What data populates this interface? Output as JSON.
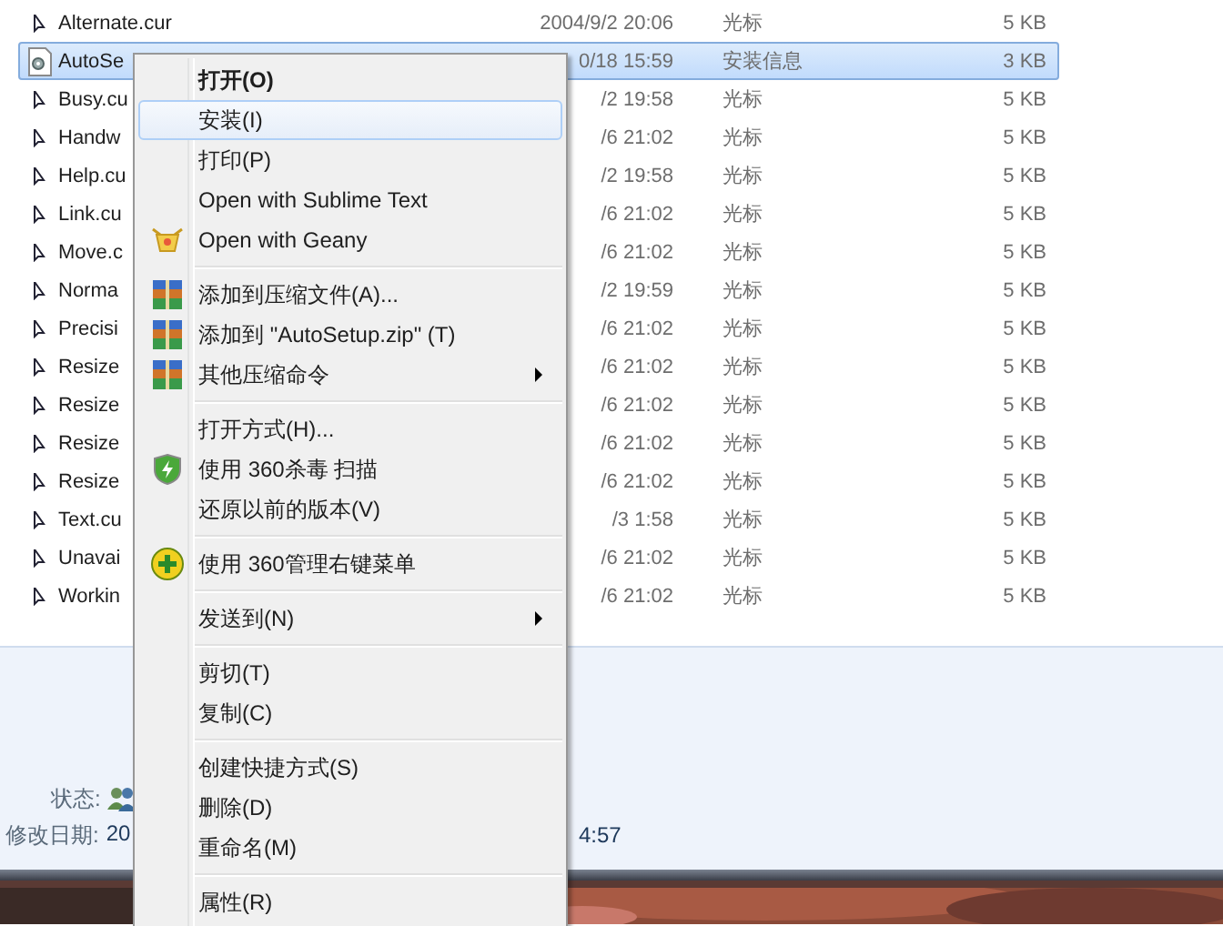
{
  "files": [
    {
      "name": "Alternate.cur",
      "date": "2004/9/2 20:06",
      "type": "光标",
      "size": "5 KB",
      "kind": "cursor",
      "selected": false
    },
    {
      "name": "AutoSe",
      "date": "0/18 15:59",
      "type": "安装信息",
      "size": "3 KB",
      "kind": "document",
      "selected": true
    },
    {
      "name": "Busy.cu",
      "date": "/2 19:58",
      "type": "光标",
      "size": "5 KB",
      "kind": "cursor",
      "selected": false
    },
    {
      "name": "Handw",
      "date": "/6 21:02",
      "type": "光标",
      "size": "5 KB",
      "kind": "cursor",
      "selected": false
    },
    {
      "name": "Help.cu",
      "date": "/2 19:58",
      "type": "光标",
      "size": "5 KB",
      "kind": "cursor",
      "selected": false
    },
    {
      "name": "Link.cu",
      "date": "/6 21:02",
      "type": "光标",
      "size": "5 KB",
      "kind": "cursor",
      "selected": false
    },
    {
      "name": "Move.c",
      "date": "/6 21:02",
      "type": "光标",
      "size": "5 KB",
      "kind": "cursor",
      "selected": false
    },
    {
      "name": "Norma",
      "date": "/2 19:59",
      "type": "光标",
      "size": "5 KB",
      "kind": "cursor",
      "selected": false
    },
    {
      "name": "Precisi",
      "date": "/6 21:02",
      "type": "光标",
      "size": "5 KB",
      "kind": "cursor",
      "selected": false
    },
    {
      "name": "Resize",
      "date": "/6 21:02",
      "type": "光标",
      "size": "5 KB",
      "kind": "cursor",
      "selected": false
    },
    {
      "name": "Resize",
      "date": "/6 21:02",
      "type": "光标",
      "size": "5 KB",
      "kind": "cursor",
      "selected": false
    },
    {
      "name": "Resize",
      "date": "/6 21:02",
      "type": "光标",
      "size": "5 KB",
      "kind": "cursor",
      "selected": false
    },
    {
      "name": "Resize",
      "date": "/6 21:02",
      "type": "光标",
      "size": "5 KB",
      "kind": "cursor",
      "selected": false
    },
    {
      "name": "Text.cu",
      "date": "/3 1:58",
      "type": "光标",
      "size": "5 KB",
      "kind": "cursor",
      "selected": false
    },
    {
      "name": "Unavai",
      "date": "/6 21:02",
      "type": "光标",
      "size": "5 KB",
      "kind": "cursor",
      "selected": false
    },
    {
      "name": "Workin",
      "date": "/6 21:02",
      "type": "光标",
      "size": "5 KB",
      "kind": "cursor",
      "selected": false
    }
  ],
  "context_menu": [
    {
      "kind": "item",
      "label": "打开(O)",
      "default": true,
      "selected": false,
      "submenu": false
    },
    {
      "kind": "item",
      "label": "安装(I)",
      "default": false,
      "selected": true,
      "submenu": false
    },
    {
      "kind": "item",
      "label": "打印(P)",
      "default": false,
      "selected": false,
      "submenu": false
    },
    {
      "kind": "item",
      "label": "Open with Sublime Text",
      "default": false,
      "selected": false,
      "submenu": false
    },
    {
      "kind": "item",
      "label": "Open with Geany",
      "default": false,
      "selected": false,
      "submenu": false
    },
    {
      "kind": "separator"
    },
    {
      "kind": "item",
      "label": "添加到压缩文件(A)...",
      "default": false,
      "selected": false,
      "submenu": false
    },
    {
      "kind": "item",
      "label": "添加到 \"AutoSetup.zip\" (T)",
      "default": false,
      "selected": false,
      "submenu": false
    },
    {
      "kind": "item",
      "label": "其他压缩命令",
      "default": false,
      "selected": false,
      "submenu": true
    },
    {
      "kind": "separator"
    },
    {
      "kind": "item",
      "label": "打开方式(H)...",
      "default": false,
      "selected": false,
      "submenu": false
    },
    {
      "kind": "item",
      "label": "使用 360杀毒 扫描",
      "default": false,
      "selected": false,
      "submenu": false
    },
    {
      "kind": "item",
      "label": "还原以前的版本(V)",
      "default": false,
      "selected": false,
      "submenu": false
    },
    {
      "kind": "separator"
    },
    {
      "kind": "item",
      "label": "使用 360管理右键菜单",
      "default": false,
      "selected": false,
      "submenu": false
    },
    {
      "kind": "separator"
    },
    {
      "kind": "item",
      "label": "发送到(N)",
      "default": false,
      "selected": false,
      "submenu": true
    },
    {
      "kind": "separator"
    },
    {
      "kind": "item",
      "label": "剪切(T)",
      "default": false,
      "selected": false,
      "submenu": false
    },
    {
      "kind": "item",
      "label": "复制(C)",
      "default": false,
      "selected": false,
      "submenu": false
    },
    {
      "kind": "separator"
    },
    {
      "kind": "item",
      "label": "创建快捷方式(S)",
      "default": false,
      "selected": false,
      "submenu": false
    },
    {
      "kind": "item",
      "label": "删除(D)",
      "default": false,
      "selected": false,
      "submenu": false
    },
    {
      "kind": "item",
      "label": "重命名(M)",
      "default": false,
      "selected": false,
      "submenu": false
    },
    {
      "kind": "separator"
    },
    {
      "kind": "item",
      "label": "属性(R)",
      "default": false,
      "selected": false,
      "submenu": false
    }
  ],
  "details": {
    "status_label": "状态:",
    "modified_label": "修改日期:",
    "modified_value_start": "20",
    "modified_value_end": "4:57"
  }
}
